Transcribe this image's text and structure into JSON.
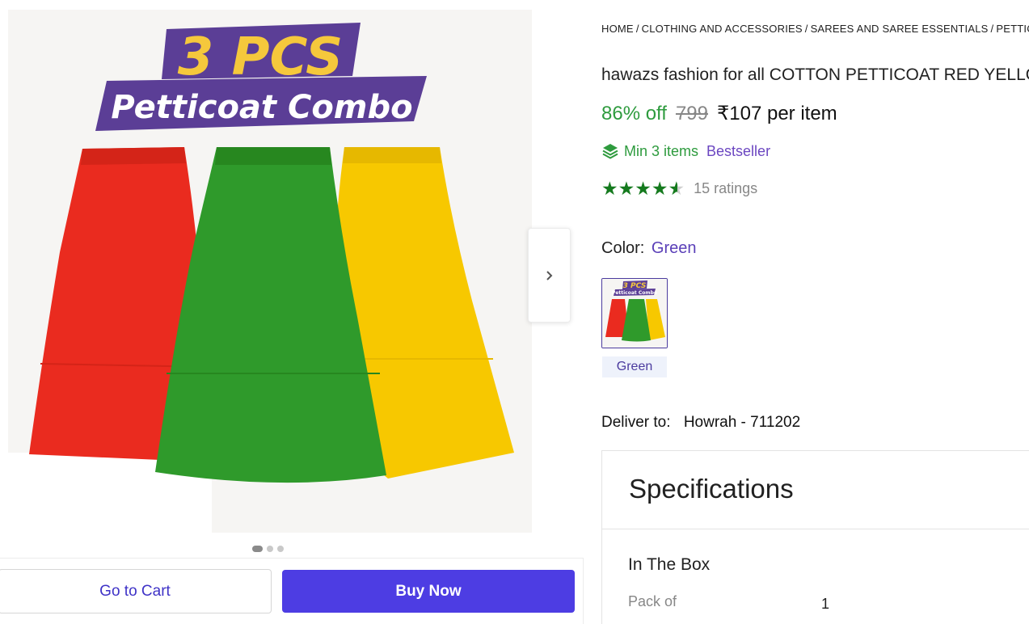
{
  "breadcrumb": {
    "items": [
      "HOME",
      "CLOTHING AND ACCESSORIES",
      "SAREES AND SAREE ESSENTIALS",
      "PETTICOATS"
    ],
    "separator": "/"
  },
  "gallery": {
    "banner_top": "3 PCS",
    "banner_bottom": "Petticoat Combo",
    "image_count": 3,
    "active_index": 0
  },
  "product": {
    "title": "hawazs fashion for all COTTON PETTICOAT RED YELLOW GREEN COMBO",
    "discount": "86% off",
    "mrp": "799",
    "price": "₹107 per item",
    "min_items": "Min 3 items",
    "badge": "Bestseller",
    "rating": 4.5,
    "rating_count": "15 ratings"
  },
  "color": {
    "label": "Color:",
    "selected": "Green",
    "swatch_label": "Green",
    "swatch_banner_top": "3 PCS",
    "swatch_banner_bottom": "Petticoat Combo"
  },
  "delivery": {
    "label": "Deliver to:",
    "location": "Howrah - 711202"
  },
  "specifications": {
    "title": "Specifications",
    "group": "In The Box",
    "rows": [
      {
        "key": "Pack of",
        "value": "1"
      }
    ]
  },
  "actions": {
    "cart_label": "Go to Cart",
    "buy_label": "Buy Now"
  },
  "colors": {
    "accent": "#4d3de3",
    "discount_green": "#2e9b3e",
    "star_green": "#157a1e",
    "banner_purple": "#5b3e96",
    "banner_yellow": "#f5c83c",
    "skirt_red": "#ea2b1f",
    "skirt_green": "#2f9a2b",
    "skirt_yellow": "#f7c800"
  },
  "icons": {
    "next": "chevron-right-icon",
    "min_items": "stack-layers-icon"
  }
}
